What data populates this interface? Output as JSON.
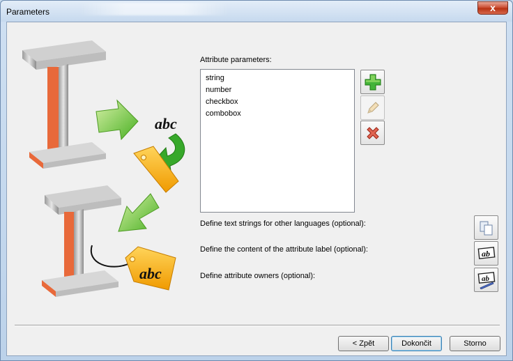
{
  "window": {
    "title": "Parameters",
    "close_glyph": "x"
  },
  "illustration": {
    "tag_text_1": "abc",
    "tag_text_2": "abc"
  },
  "attributes": {
    "label": "Attribute parameters:",
    "items": [
      "string",
      "number",
      "checkbox",
      "combobox"
    ]
  },
  "side_buttons": {
    "add": "add-icon",
    "edit": "pencil-icon",
    "delete": "delete-icon"
  },
  "options": {
    "languages_label": "Define text strings for other languages (optional):",
    "attribute_label_label": "Define the content of the attribute label (optional):",
    "owners_label": "Define attribute owners (optional):",
    "label_icon_text": "ab",
    "owners_icon_text": "ab"
  },
  "footer": {
    "back_label": "< Zpět",
    "finish_label": "Dokončit",
    "cancel_label": "Storno"
  },
  "colors": {
    "accent_green": "#3aa635",
    "delete_red": "#d23b2a",
    "tag_orange": "#f2a20f",
    "beam_orange": "#e8693a"
  }
}
